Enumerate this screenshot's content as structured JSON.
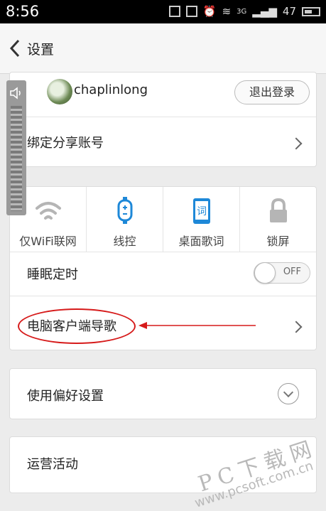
{
  "status_bar": {
    "time": "8:56",
    "network": "3G",
    "battery": "47"
  },
  "nav": {
    "title": "设置"
  },
  "account": {
    "username": "chaplinlong",
    "logout_label": "退出登录",
    "bind_label": "绑定分享账号"
  },
  "quick_settings": [
    {
      "label": "仅WiFi联网",
      "icon": "wifi-icon"
    },
    {
      "label": "线控",
      "icon": "remote-control-icon"
    },
    {
      "label": "桌面歌词",
      "icon": "desktop-lyrics-icon"
    },
    {
      "label": "锁屏",
      "icon": "lock-icon"
    }
  ],
  "desktop_lyrics_glyph": "词",
  "sleep_timer": {
    "label": "睡眠定时",
    "toggle_text": "OFF"
  },
  "pc_client": {
    "label": "电脑客户端导歌"
  },
  "preferences": {
    "label": "使用偏好设置"
  },
  "campaign": {
    "label": "运营活动"
  },
  "watermark": {
    "line1": "PC下载网",
    "line2": "www.pcsoft.com.cn"
  },
  "colors": {
    "accent_blue": "#1e88d8",
    "annotation_red": "#d61a1a"
  }
}
